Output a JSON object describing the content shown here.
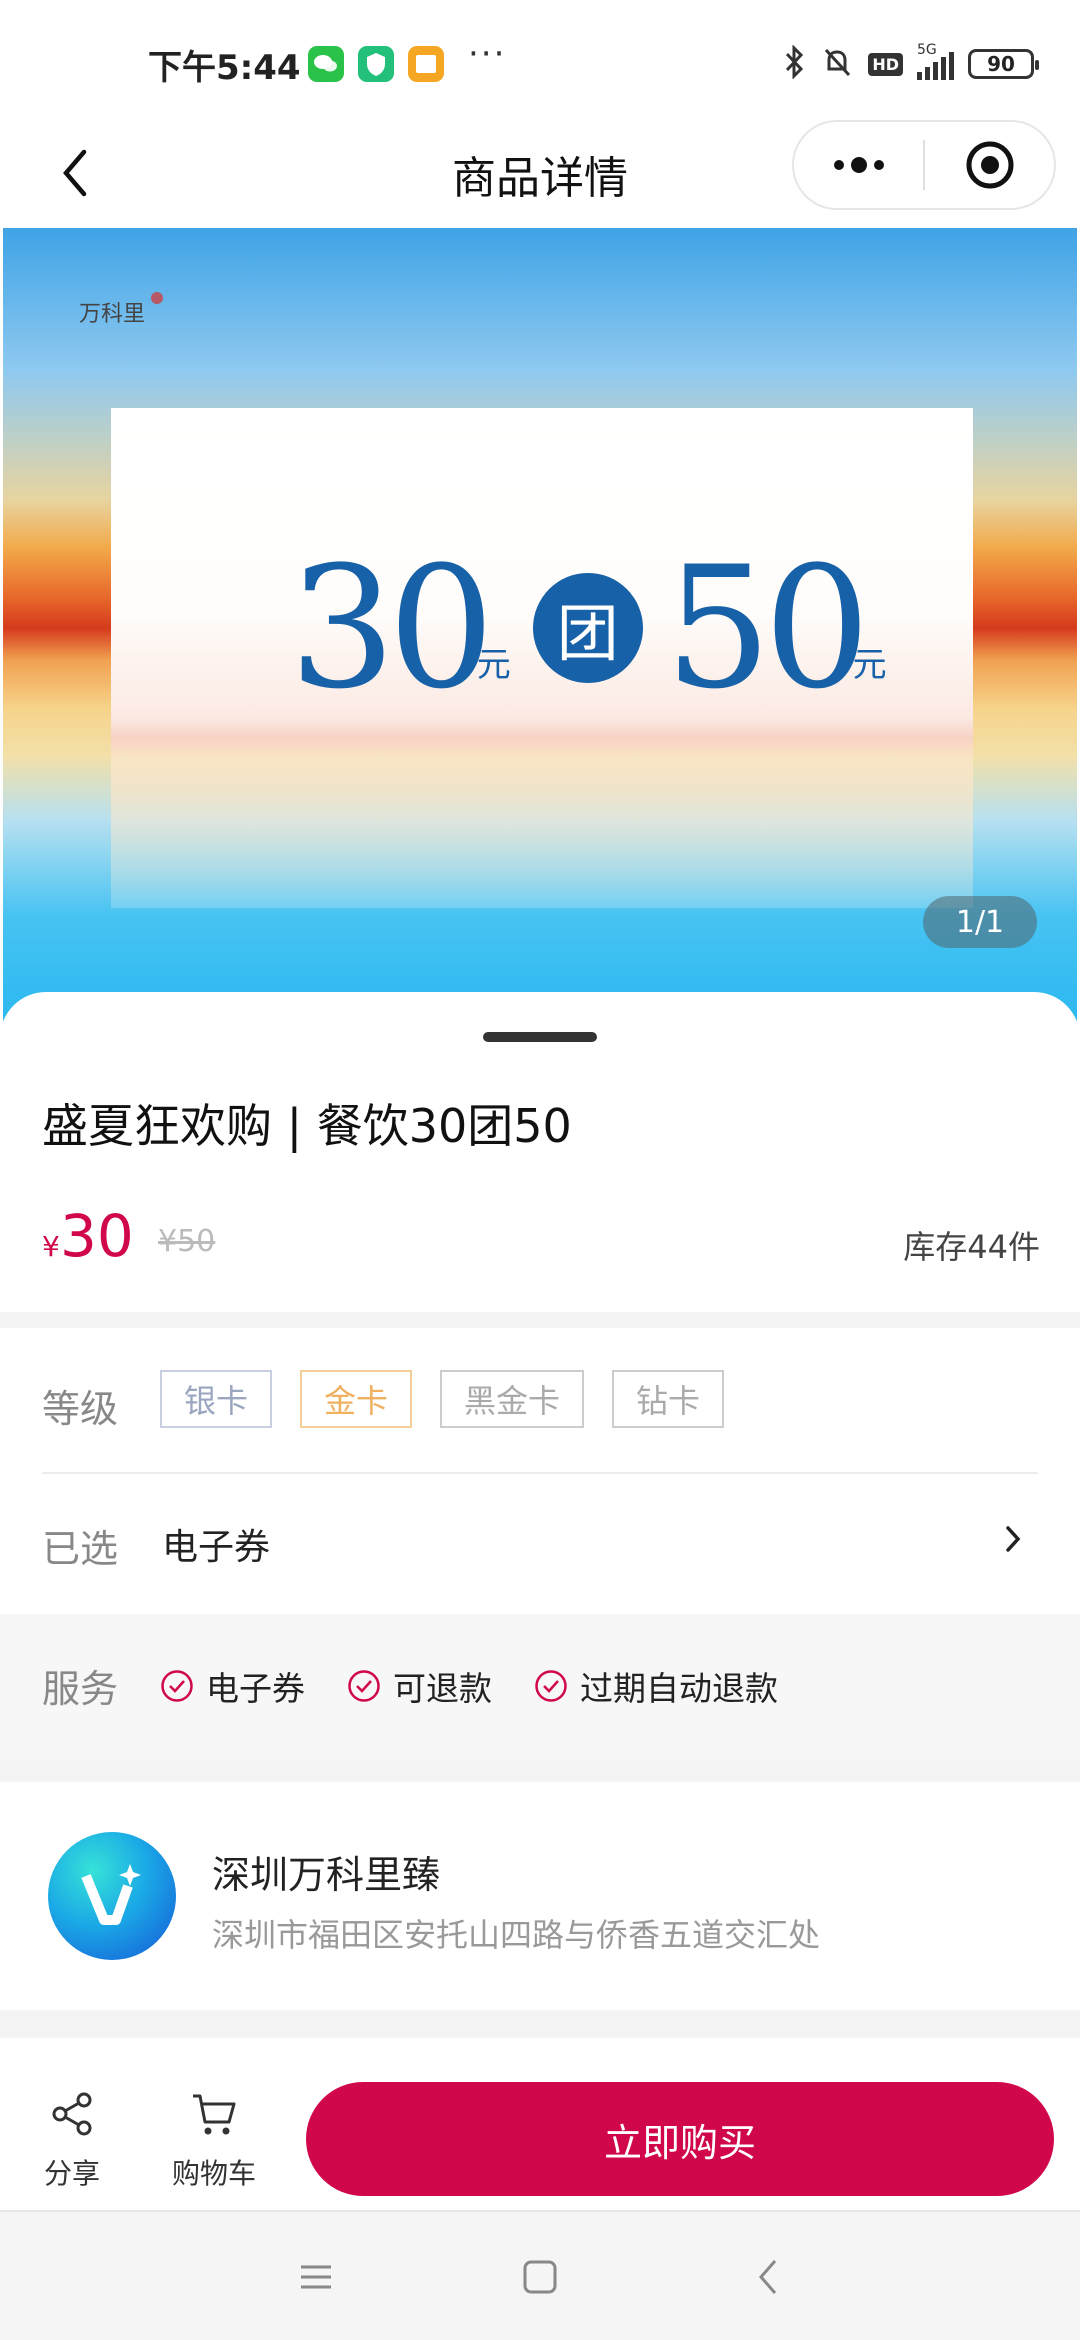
{
  "status_bar": {
    "time": "下午5:44",
    "more": "···",
    "battery": "90",
    "network": "5G"
  },
  "nav": {
    "title": "商品详情"
  },
  "banner": {
    "brand": "万科里",
    "big_left": "30",
    "unit_left": "元",
    "circle": "团",
    "big_right": "50",
    "unit_right": "元",
    "pager": "1/1"
  },
  "product": {
    "title": "盛夏狂欢购 | 餐饮30团50",
    "currency": "¥",
    "price": "30",
    "original_price": "¥50",
    "stock": "库存44件"
  },
  "spec": {
    "level_label": "等级",
    "levels": [
      "银卡",
      "金卡",
      "黑金卡",
      "钻卡"
    ],
    "selected_label": "已选",
    "selected_value": "电子券"
  },
  "service": {
    "label": "服务",
    "items": [
      "电子券",
      "可退款",
      "过期自动退款"
    ]
  },
  "store": {
    "name": "深圳万科里臻",
    "address": "深圳市福田区安托山四路与侨香五道交汇处"
  },
  "bottom": {
    "share": "分享",
    "cart": "购物车",
    "buy": "立即购买"
  },
  "colors": {
    "accent": "#d0074a",
    "gold": "#f0b060",
    "promo_blue": "#1761a8"
  }
}
